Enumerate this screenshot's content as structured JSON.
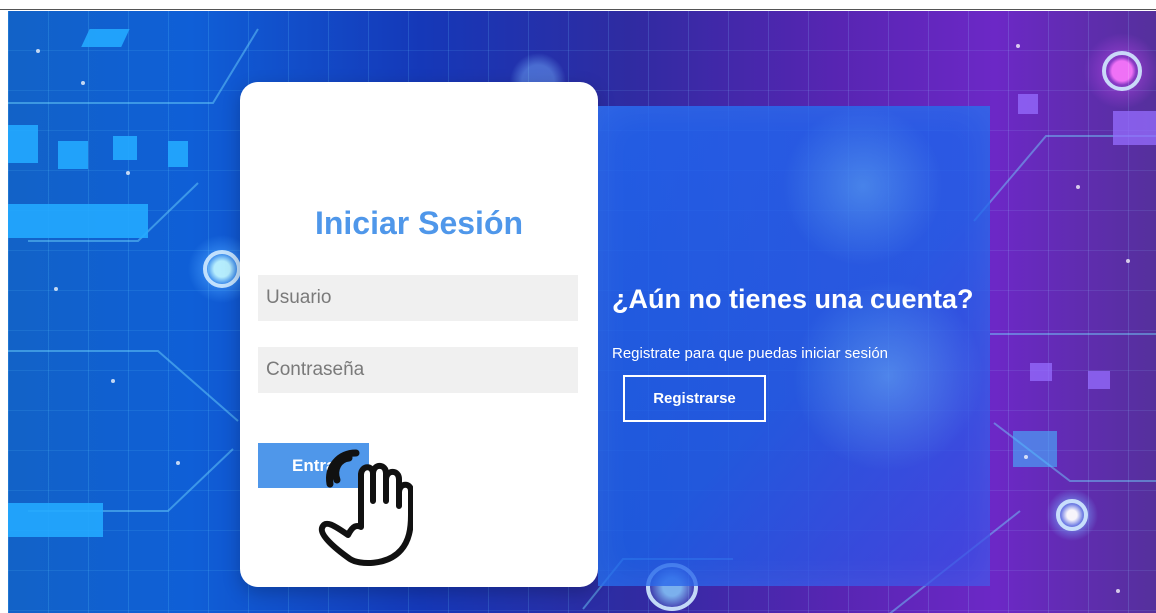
{
  "login": {
    "title": "Iniciar Sesión",
    "username_placeholder": "Usuario",
    "password_placeholder": "Contraseña",
    "submit_label": "Entrar"
  },
  "register": {
    "title": "¿Aún no tienes una cuenta?",
    "description": "Registrate para que puedas iniciar sesión",
    "button_label": "Registrarse"
  },
  "icons": {
    "cursor": "pointer-hand-icon",
    "background": "circuit-tech-pattern"
  },
  "colors": {
    "primary_blue": "#4f97ea",
    "card_white": "#ffffff",
    "input_gray": "#f0f0f0",
    "register_panel_blue": "#2167f2"
  }
}
